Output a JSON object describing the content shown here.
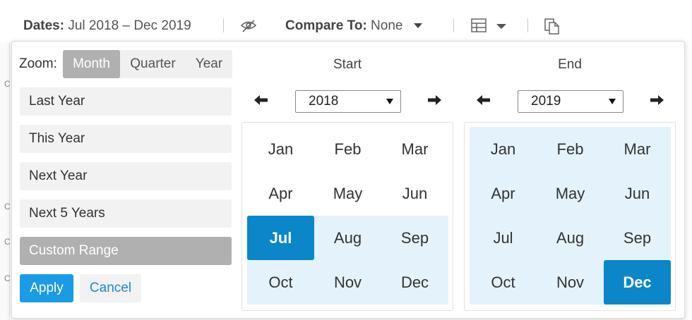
{
  "toolbar": {
    "dates_label": "Dates:",
    "dates_value": "Jul 2018 – Dec 2019",
    "compare_label": "Compare To:",
    "compare_value": "None"
  },
  "side_glyphs": [
    "C",
    "C",
    "C",
    "C"
  ],
  "zoom": {
    "label": "Zoom:",
    "options": [
      "Month",
      "Quarter",
      "Year"
    ],
    "active": "Month"
  },
  "presets": [
    "Last Year",
    "This Year",
    "Next Year",
    "Next 5 Years",
    "Custom Range"
  ],
  "active_preset": "Custom Range",
  "actions": {
    "apply": "Apply",
    "cancel": "Cancel"
  },
  "start": {
    "title": "Start",
    "year": "2018",
    "months": [
      "Jan",
      "Feb",
      "Mar",
      "Apr",
      "May",
      "Jun",
      "Jul",
      "Aug",
      "Sep",
      "Oct",
      "Nov",
      "Dec"
    ],
    "selected_month": "Jul"
  },
  "end": {
    "title": "End",
    "year": "2019",
    "months": [
      "Jan",
      "Feb",
      "Mar",
      "Apr",
      "May",
      "Jun",
      "Jul",
      "Aug",
      "Sep",
      "Oct",
      "Nov",
      "Dec"
    ],
    "selected_month": "Dec"
  },
  "colors": {
    "accent": "#0a86c9",
    "apply": "#1a9be6",
    "range_highlight": "#e3f2fb",
    "active_gray": "#b0b0b0"
  }
}
